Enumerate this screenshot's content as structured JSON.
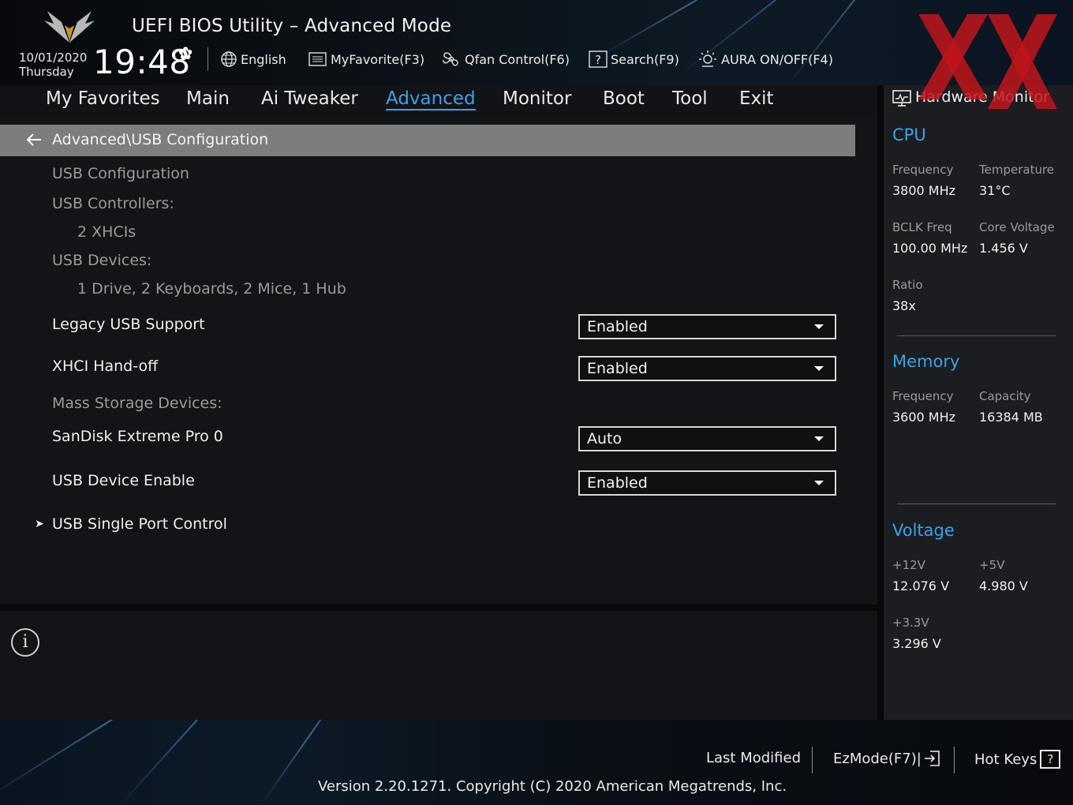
{
  "header": {
    "title": "UEFI BIOS Utility – Advanced Mode",
    "date": "10/01/2020",
    "weekday": "Thursday",
    "time": "19:48",
    "tools": {
      "language": "English",
      "my_favorite": "MyFavorite(F3)",
      "qfan": "Qfan Control(F6)",
      "search": "Search(F9)",
      "aura": "AURA ON/OFF(F4)"
    }
  },
  "nav": {
    "tabs": [
      "My Favorites",
      "Main",
      "Ai Tweaker",
      "Advanced",
      "Monitor",
      "Boot",
      "Tool",
      "Exit"
    ],
    "active": "Advanced"
  },
  "main": {
    "breadcrumb": "Advanced\\USB Configuration",
    "usb_configuration": "USB Configuration",
    "usb_controllers_label": "USB Controllers:",
    "usb_controllers_value": "2 XHCIs",
    "usb_devices_label": "USB Devices:",
    "usb_devices_value": "1 Drive, 2 Keyboards, 2 Mice, 1 Hub",
    "mass_storage_label": "Mass Storage Devices:",
    "settings": {
      "legacy_usb": {
        "label": "Legacy USB Support",
        "value": "Enabled"
      },
      "xhci_handoff": {
        "label": "XHCI Hand-off",
        "value": "Enabled"
      },
      "sandisk": {
        "label": "SanDisk Extreme Pro 0",
        "value": "Auto"
      },
      "usb_device_enable": {
        "label": "USB Device Enable",
        "value": "Enabled"
      }
    },
    "submenu": "USB Single Port Control"
  },
  "hardware_monitor": {
    "title": "Hardware Monitor",
    "cpu": {
      "heading": "CPU",
      "frequency_label": "Frequency",
      "frequency": "3800 MHz",
      "temperature_label": "Temperature",
      "temperature": "31°C",
      "bclk_label": "BCLK Freq",
      "bclk": "100.00 MHz",
      "core_voltage_label": "Core Voltage",
      "core_voltage": "1.456 V",
      "ratio_label": "Ratio",
      "ratio": "38x"
    },
    "memory": {
      "heading": "Memory",
      "frequency_label": "Frequency",
      "frequency": "3600 MHz",
      "capacity_label": "Capacity",
      "capacity": "16384 MB"
    },
    "voltage": {
      "heading": "Voltage",
      "v12_label": "+12V",
      "v12": "12.076 V",
      "v5_label": "+5V",
      "v5": "4.980 V",
      "v33_label": "+3.3V",
      "v33": "3.296 V"
    }
  },
  "footer": {
    "last_modified": "Last Modified",
    "ezmode": "EzMode(F7)|",
    "hot_keys": "Hot Keys",
    "hot_keys_icon": "?",
    "version": "Version 2.20.1271. Copyright (C) 2020 American Megatrends, Inc."
  },
  "colors": {
    "accent": "#3aa3e8",
    "breadcrumb_bg": "#7d7d7d",
    "panel_bg": "#131417",
    "monitor_bg": "#1b1d21",
    "watermark_red": "#c0151b"
  }
}
